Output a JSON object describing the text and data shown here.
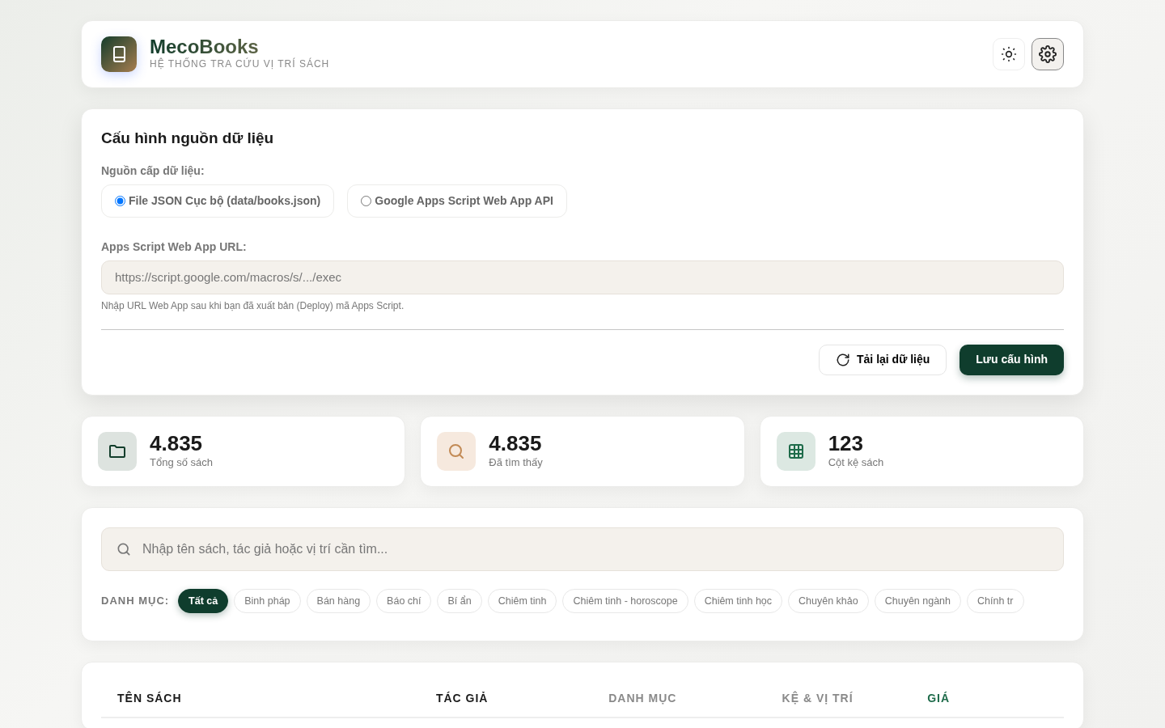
{
  "header": {
    "brand": "MecoBooks",
    "subtitle": "HỆ THỐNG TRA CỨU VỊ TRÍ SÁCH"
  },
  "config": {
    "title": "Cấu hình nguồn dữ liệu",
    "source_label": "Nguồn cấp dữ liệu:",
    "sources": [
      {
        "label": "File JSON Cục bộ (data/books.json)",
        "selected": true
      },
      {
        "label": "Google Apps Script Web App API",
        "selected": false
      }
    ],
    "url_label": "Apps Script Web App URL:",
    "url_placeholder": "https://script.google.com/macros/s/.../exec",
    "hint": "Nhập URL Web App sau khi bạn đã xuất bản (Deploy) mã Apps Script.",
    "reload_button": "Tải lại dữ liệu",
    "save_button": "Lưu cấu hình"
  },
  "stats": [
    {
      "kind": "folder",
      "value": "4.835",
      "label": "Tổng số sách"
    },
    {
      "kind": "search",
      "value": "4.835",
      "label": "Đã tìm thấy"
    },
    {
      "kind": "grid",
      "value": "123",
      "label": "Cột kệ sách"
    }
  ],
  "search": {
    "placeholder": "Nhập tên sách, tác giả hoặc vị trí cần tìm...",
    "category_label": "DANH MỤC:",
    "categories": [
      {
        "label": "Tất cả",
        "selected": true
      },
      {
        "label": "Binh pháp",
        "selected": false
      },
      {
        "label": "Bán hàng",
        "selected": false
      },
      {
        "label": "Báo chí",
        "selected": false
      },
      {
        "label": "Bí ẩn",
        "selected": false
      },
      {
        "label": "Chiêm tinh",
        "selected": false
      },
      {
        "label": "Chiêm tinh - horoscope",
        "selected": false
      },
      {
        "label": "Chiêm tinh học",
        "selected": false
      },
      {
        "label": "Chuyên khảo",
        "selected": false
      },
      {
        "label": "Chuyên ngành",
        "selected": false
      },
      {
        "label": "Chính tr",
        "selected": false
      }
    ]
  },
  "table": {
    "columns": [
      {
        "label": "TÊN SÁCH",
        "color": "#1a1a1a"
      },
      {
        "label": "TÁC GIẢ",
        "color": "#1a1a1a"
      },
      {
        "label": "DANH MỤC",
        "color": "#8a8a8a"
      },
      {
        "label": "KỆ & VỊ TRÍ",
        "color": "#8a8a8a"
      },
      {
        "label": "GIÁ",
        "color": "#1e6b4a"
      }
    ]
  }
}
